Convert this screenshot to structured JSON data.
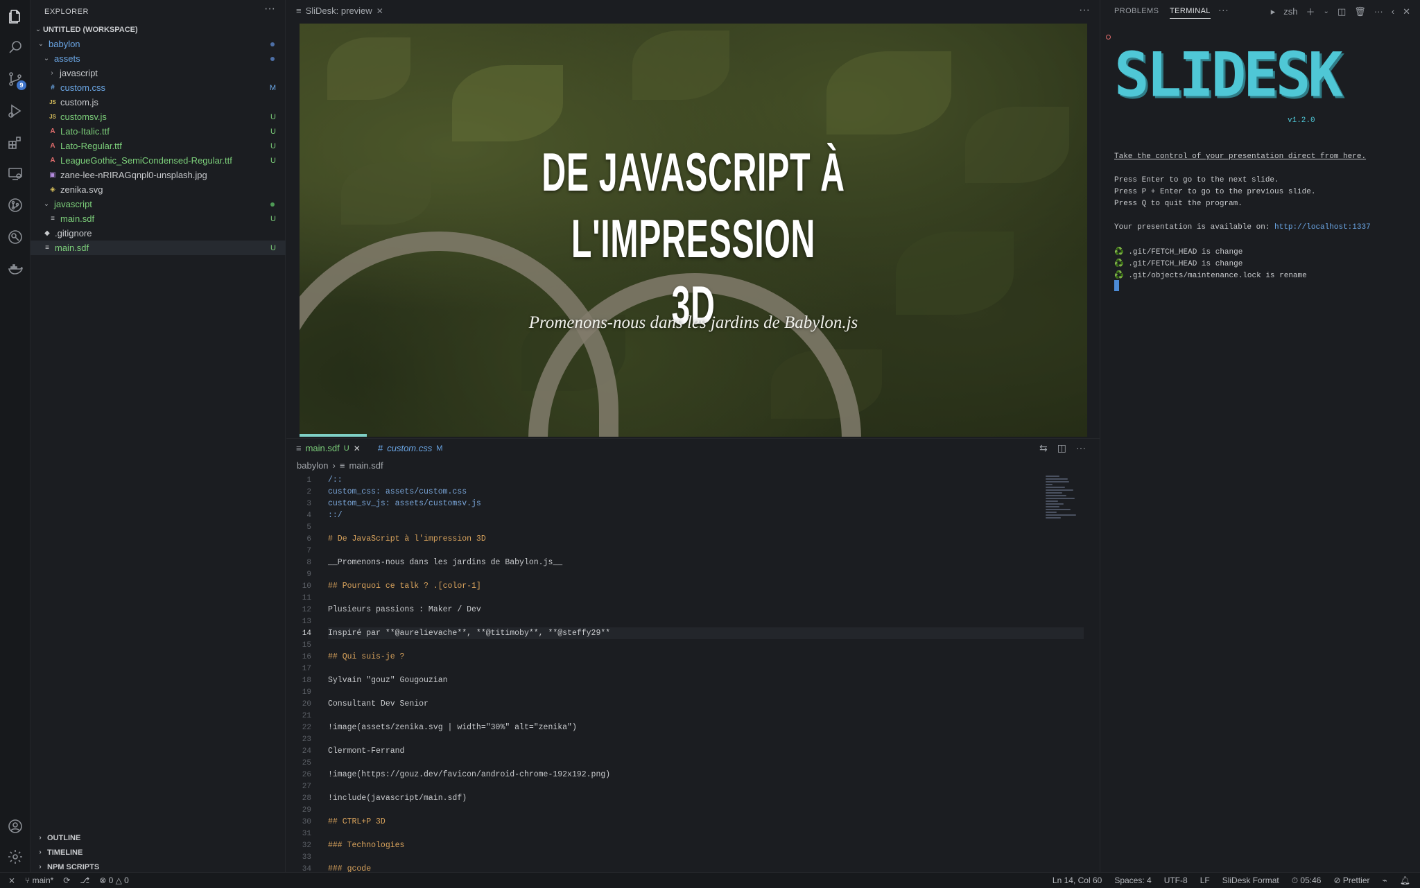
{
  "explorer": {
    "title": "EXPLORER",
    "workspace": "UNTITLED (WORKSPACE)",
    "items": [
      {
        "label": "babylon",
        "depth": 1,
        "type": "folder-open",
        "color": "c-blue",
        "marker": "dot"
      },
      {
        "label": "assets",
        "depth": 2,
        "type": "folder-open",
        "color": "c-blue",
        "marker": "dot"
      },
      {
        "label": "javascript",
        "depth": 3,
        "type": "folder",
        "color": "c-gray",
        "marker": ""
      },
      {
        "label": "custom.css",
        "depth": 3,
        "type": "css",
        "color": "c-blue",
        "marker": "M"
      },
      {
        "label": "custom.js",
        "depth": 3,
        "type": "js",
        "color": "c-gray",
        "marker": ""
      },
      {
        "label": "customsv.js",
        "depth": 3,
        "type": "js",
        "color": "c-green",
        "marker": "U"
      },
      {
        "label": "Lato-Italic.ttf",
        "depth": 3,
        "type": "font",
        "color": "c-green",
        "marker": "U"
      },
      {
        "label": "Lato-Regular.ttf",
        "depth": 3,
        "type": "font",
        "color": "c-green",
        "marker": "U"
      },
      {
        "label": "LeagueGothic_SemiCondensed-Regular.ttf",
        "depth": 3,
        "type": "font",
        "color": "c-green",
        "marker": "U"
      },
      {
        "label": "zane-lee-nRIRAGqnpl0-unsplash.jpg",
        "depth": 3,
        "type": "img",
        "color": "c-gray",
        "marker": ""
      },
      {
        "label": "zenika.svg",
        "depth": 3,
        "type": "svg",
        "color": "c-gray",
        "marker": ""
      },
      {
        "label": "javascript",
        "depth": 2,
        "type": "folder-open",
        "color": "c-green",
        "marker": "dotg"
      },
      {
        "label": "main.sdf",
        "depth": 3,
        "type": "sdf",
        "color": "c-green",
        "marker": "U"
      },
      {
        "label": ".gitignore",
        "depth": 2,
        "type": "git",
        "color": "c-gray",
        "marker": ""
      },
      {
        "label": "main.sdf",
        "depth": 2,
        "type": "sdf",
        "color": "c-green",
        "marker": "U",
        "selected": true
      }
    ],
    "bottom": [
      "OUTLINE",
      "TIMELINE",
      "NPM SCRIPTS"
    ]
  },
  "activity": {
    "scm_badge": "9"
  },
  "preview": {
    "tab_label": "SliDesk: preview",
    "slide_title_line1": "DE JAVASCRIPT À L'IMPRESSION",
    "slide_title_line2": "3D",
    "slide_subtitle": "Promenons-nous dans les jardins de Babylon.js",
    "progress": 0.085
  },
  "editor": {
    "tabs": [
      {
        "label": "main.sdf",
        "status": "U",
        "active": true
      },
      {
        "label": "custom.css",
        "status": "M",
        "active": false
      }
    ],
    "breadcrumb": [
      "babylon",
      "main.sdf"
    ],
    "current_line": 14,
    "lines": [
      {
        "n": "1",
        "t": "/::",
        "c": "meta"
      },
      {
        "n": "2",
        "t": "custom_css: assets/custom.css",
        "c": "meta"
      },
      {
        "n": "3",
        "t": "custom_sv_js: assets/customsv.js",
        "c": "meta"
      },
      {
        "n": "4",
        "t": "::/",
        "c": "meta"
      },
      {
        "n": "5",
        "t": "",
        "c": ""
      },
      {
        "n": "6",
        "t": "# De JavaScript à l'impression 3D",
        "c": "head"
      },
      {
        "n": "7",
        "t": "",
        "c": ""
      },
      {
        "n": "8",
        "t": "__Promenons-nous dans les jardins de Babylon.js__",
        "c": "bold"
      },
      {
        "n": "9",
        "t": "",
        "c": ""
      },
      {
        "n": "10",
        "t": "## Pourquoi ce talk ? .[color-1]",
        "c": "head"
      },
      {
        "n": "11",
        "t": "",
        "c": ""
      },
      {
        "n": "12",
        "t": "Plusieurs passions : Maker / Dev",
        "c": ""
      },
      {
        "n": "13",
        "t": "",
        "c": ""
      },
      {
        "n": "14",
        "t": "Inspiré par **@aurelievache**, **@titimoby**, **@steffy29**",
        "c": ""
      },
      {
        "n": "15",
        "t": "",
        "c": ""
      },
      {
        "n": "16",
        "t": "## Qui suis-je ?",
        "c": "head"
      },
      {
        "n": "17",
        "t": "",
        "c": ""
      },
      {
        "n": "18",
        "t": "Sylvain \"gouz\" Gougouzian",
        "c": ""
      },
      {
        "n": "19",
        "t": "",
        "c": ""
      },
      {
        "n": "20",
        "t": "Consultant Dev Senior",
        "c": ""
      },
      {
        "n": "21",
        "t": "",
        "c": ""
      },
      {
        "n": "22",
        "t": "!image(assets/zenika.svg | width=\"30%\" alt=\"zenika\")",
        "c": ""
      },
      {
        "n": "23",
        "t": "",
        "c": ""
      },
      {
        "n": "24",
        "t": "Clermont-Ferrand",
        "c": ""
      },
      {
        "n": "25",
        "t": "",
        "c": ""
      },
      {
        "n": "26",
        "t": "!image(https://gouz.dev/favicon/android-chrome-192x192.png)",
        "c": ""
      },
      {
        "n": "27",
        "t": "",
        "c": ""
      },
      {
        "n": "28",
        "t": "!include(javascript/main.sdf)",
        "c": ""
      },
      {
        "n": "29",
        "t": "",
        "c": ""
      },
      {
        "n": "30",
        "t": "## CTRL+P 3D",
        "c": "head"
      },
      {
        "n": "31",
        "t": "",
        "c": ""
      },
      {
        "n": "32",
        "t": "### Technologies",
        "c": "head"
      },
      {
        "n": "33",
        "t": "",
        "c": ""
      },
      {
        "n": "34",
        "t": "### gcode",
        "c": "head"
      }
    ]
  },
  "panel": {
    "tabs": [
      "PROBLEMS",
      "TERMINAL"
    ],
    "shell": "zsh",
    "logo_text": "SLIDESK",
    "version": "v1.2.0",
    "lines": [
      "Take the control of your presentation direct from here.",
      "",
      "Press Enter to go to the next slide.",
      "Press P + Enter to go to the previous slide.",
      "Press Q to quit the program.",
      "",
      "Your presentation is available on: ",
      "",
      "♻️ .git/FETCH_HEAD is change",
      "♻️ .git/FETCH_HEAD is change",
      "♻️ .git/objects/maintenance.lock is rename"
    ],
    "url": "http://localhost:1337"
  },
  "status": {
    "branch": "main*",
    "errors": "0",
    "warnings": "0",
    "position": "Ln 14, Col 60",
    "spaces": "Spaces: 4",
    "encoding": "UTF-8",
    "eol": "LF",
    "format": "SliDesk Format",
    "time": "05:46",
    "prettier": "Prettier"
  }
}
